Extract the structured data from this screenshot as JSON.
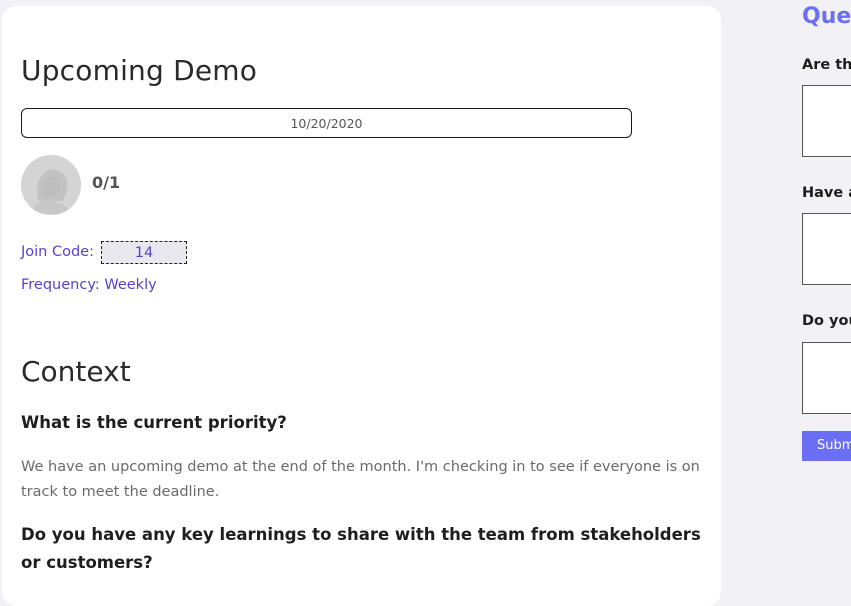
{
  "demo": {
    "title": "Upcoming Demo",
    "date": "10/20/2020",
    "participant_count": "0/1",
    "join_code_label": "Join Code:",
    "join_code": "14",
    "frequency_label": "Frequency: Weekly"
  },
  "context": {
    "title": "Context",
    "questions": [
      {
        "question": "What is the current priority?",
        "answer": "We have an upcoming demo at the end of the month. I'm checking in to see if everyone is on track to meet the deadline."
      },
      {
        "question": "Do you have any key learnings to share with the team from stakeholders or customers?"
      }
    ]
  },
  "sidebar": {
    "title": "Ques",
    "questions": [
      "Are th",
      "Have a",
      "Do you"
    ],
    "submit_label": "Subm"
  },
  "colors": {
    "accent": "#6b6ff5",
    "link": "#5a3fd0",
    "background": "#f1f1f6"
  }
}
